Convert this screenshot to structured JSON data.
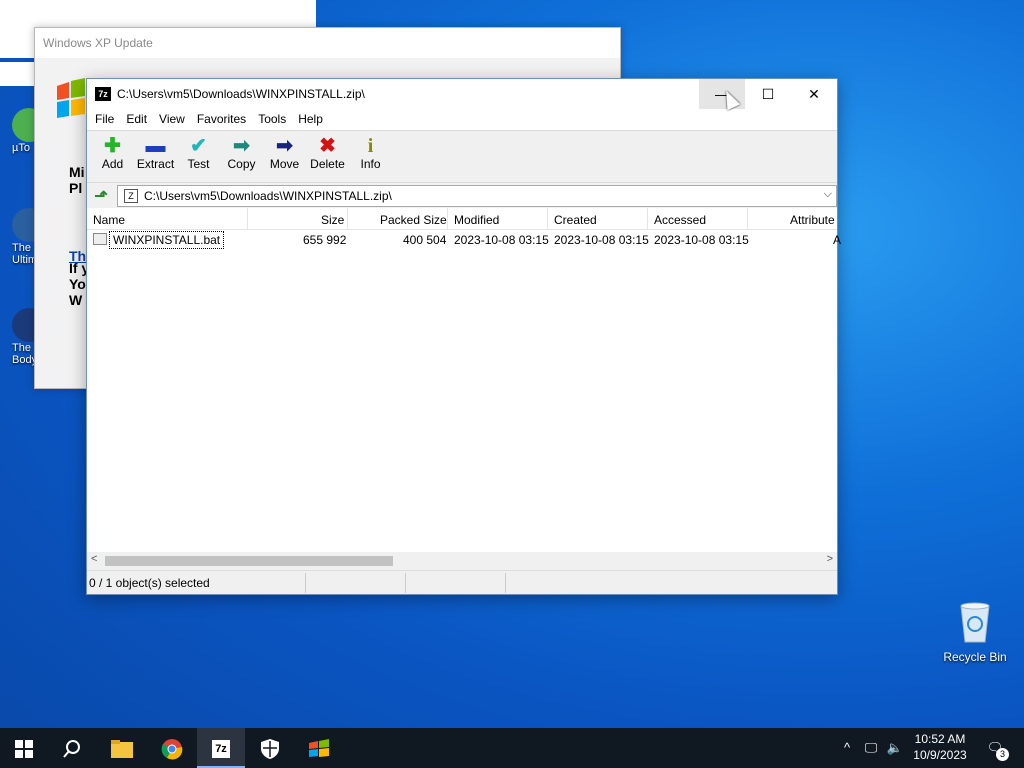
{
  "xp_window": {
    "title": "Windows XP Update",
    "text_1a": "Mi",
    "text_1b": "Pl",
    "link": "Th",
    "text_2a": "If y",
    "text_2b": "Yo",
    "text_2c": "W"
  },
  "desktop_icons": [
    {
      "label_1": "µTo",
      "label_2": ""
    },
    {
      "label_1": "The",
      "label_2": "Ultim"
    },
    {
      "label_1": "The",
      "label_2": "Body"
    }
  ],
  "recycle_bin": {
    "label": "Recycle Bin"
  },
  "zip_window": {
    "title": "C:\\Users\\vm5\\Downloads\\WINXPINSTALL.zip\\",
    "app_icon_text": "7z",
    "menu": [
      "File",
      "Edit",
      "View",
      "Favorites",
      "Tools",
      "Help"
    ],
    "toolbar": [
      {
        "label": "Add",
        "icon": "add-icon",
        "glyph": "✚",
        "color": "#28b428"
      },
      {
        "label": "Extract",
        "icon": "extract-icon",
        "glyph": "▬",
        "color": "#1a3fbf"
      },
      {
        "label": "Test",
        "icon": "test-icon",
        "glyph": "✔",
        "color": "#22b5b5"
      },
      {
        "label": "Copy",
        "icon": "copy-icon",
        "glyph": "➡",
        "color": "#1f8a7a"
      },
      {
        "label": "Move",
        "icon": "move-icon",
        "glyph": "➡",
        "color": "#1a237e"
      },
      {
        "label": "Delete",
        "icon": "delete-icon",
        "glyph": "✖",
        "color": "#d01515"
      },
      {
        "label": "Info",
        "icon": "info-icon",
        "glyph": "i",
        "color": "#8a8a00"
      }
    ],
    "address": "C:\\Users\\vm5\\Downloads\\WINXPINSTALL.zip\\",
    "columns": [
      "Name",
      "Size",
      "Packed Size",
      "Modified",
      "Created",
      "Accessed",
      "Attribute"
    ],
    "rows": [
      {
        "name": "WINXPINSTALL.bat",
        "size": "655 992",
        "packed": "400 504",
        "modified": "2023-10-08 03:15",
        "created": "2023-10-08 03:15",
        "accessed": "2023-10-08 03:15",
        "attr": "A"
      }
    ],
    "status": "0 / 1 object(s) selected"
  },
  "taskbar": {
    "time": "10:52 AM",
    "date": "10/9/2023",
    "notification_count": "3",
    "items": [
      "start-icon",
      "search-icon",
      "file-explorer-icon",
      "chrome-icon",
      "7zip-icon",
      "security-icon",
      "windows-xp-icon"
    ],
    "seven_zip_text": "7z"
  }
}
